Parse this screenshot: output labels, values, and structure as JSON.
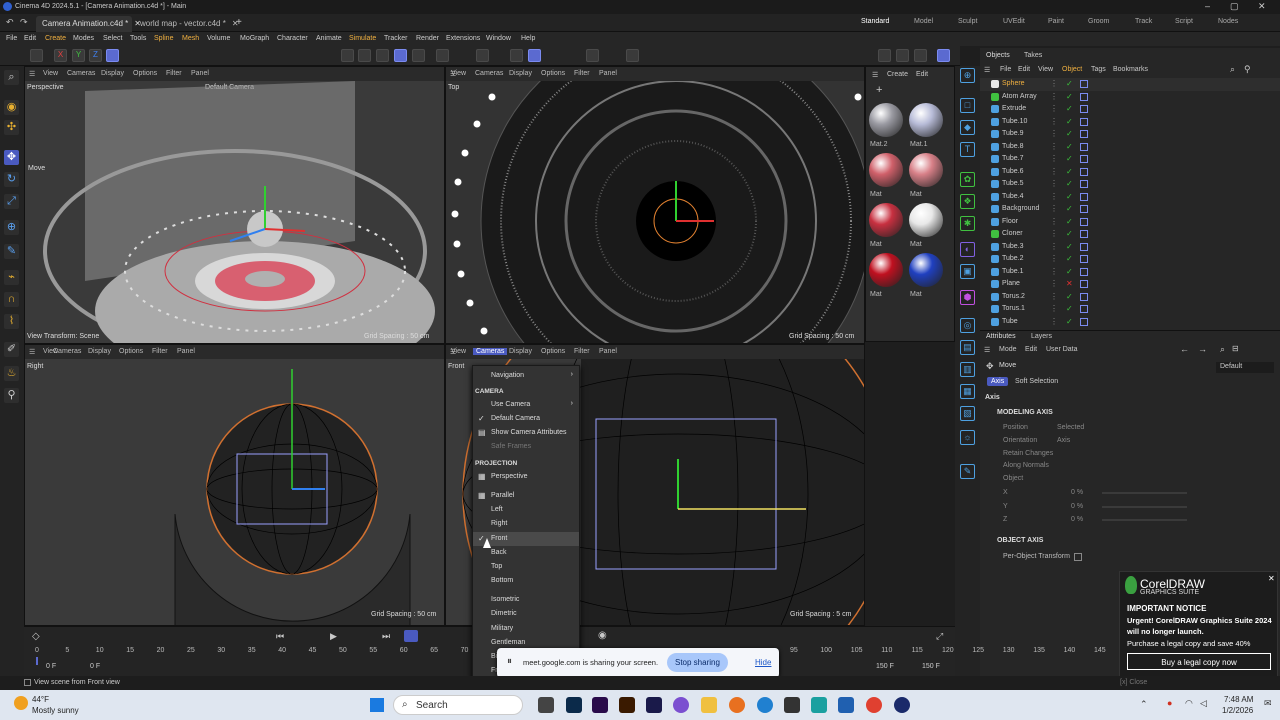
{
  "window": {
    "title": "Cinema 4D 2024.5.1 - [Camera Animation.c4d *] - Main"
  },
  "tabs": [
    {
      "label": "Camera Animation.c4d *",
      "active": true
    },
    {
      "label": "world map - vector.c4d *",
      "active": false
    }
  ],
  "layouts": [
    "Standard",
    "Model",
    "Sculpt",
    "UVEdit",
    "Paint",
    "Groom",
    "Track",
    "Script",
    "Nodes"
  ],
  "menu": [
    "File",
    "Edit",
    "Create",
    "Modes",
    "Select",
    "Tools",
    "Spline",
    "Mesh",
    "Volume",
    "MoGraph",
    "Character",
    "Animate",
    "Simulate",
    "Tracker",
    "Render",
    "Extensions",
    "Window",
    "Help"
  ],
  "viewport_menu": [
    "View",
    "Cameras",
    "Display",
    "Options",
    "Filter",
    "Panel"
  ],
  "viewports": {
    "perspective": {
      "label": "Perspective",
      "camera": "Default Camera",
      "tool": "Move",
      "transform": "View Transform: Scene",
      "grid": "Grid Spacing : 50 cm"
    },
    "top": {
      "label": "Top",
      "grid": "Grid Spacing : 50 cm"
    },
    "right": {
      "label": "Right",
      "grid": "Grid Spacing : 50 cm"
    },
    "front": {
      "label": "Front",
      "grid": "Grid Spacing : 5 cm"
    }
  },
  "materials": {
    "menu": [
      "Create",
      "Edit"
    ],
    "items": [
      {
        "name": "Mat.2",
        "color": "#9a9aa2"
      },
      {
        "name": "Mat.1",
        "color": "#b8bcd8"
      },
      {
        "name": "Mat",
        "color": "#d0606a"
      },
      {
        "name": "Mat",
        "color": "#d88088"
      },
      {
        "name": "Mat",
        "color": "#c83040"
      },
      {
        "name": "Mat",
        "color": "#e8e8e8"
      },
      {
        "name": "Mat",
        "color": "#c01020"
      },
      {
        "name": "Mat",
        "color": "#2040c0"
      }
    ]
  },
  "objects": {
    "tabs": [
      "Objects",
      "Takes"
    ],
    "menu": [
      "File",
      "Edit",
      "View",
      "Object",
      "Tags",
      "Bookmarks"
    ],
    "items": [
      "Sphere",
      "Atom Array",
      "Extrude",
      "Tube.10",
      "Tube.9",
      "Tube.8",
      "Tube.7",
      "Tube.6",
      "Tube.5",
      "Tube.4",
      "Background",
      "Floor",
      "Cloner",
      "Tube.3",
      "Tube.2",
      "Tube.1",
      "Plane",
      "Torus.2",
      "Torus.1",
      "Tube"
    ]
  },
  "attributes": {
    "tabs": [
      "Attributes",
      "Layers"
    ],
    "menu": [
      "Mode",
      "Edit",
      "User Data"
    ],
    "tool": "Move",
    "preset": "Default",
    "subtabs": [
      "Axis",
      "Soft Selection"
    ],
    "section": "Axis",
    "modeling_axis": "MODELING AXIS",
    "fields": [
      {
        "label": "Position",
        "value": "Selected"
      },
      {
        "label": "Orientation",
        "value": "Axis"
      },
      {
        "label": "Retain Changes",
        "value": ""
      },
      {
        "label": "Along Normals",
        "value": ""
      },
      {
        "label": "Object",
        "value": ""
      },
      {
        "label": "X",
        "value": "0 %"
      },
      {
        "label": "Y",
        "value": "0 %"
      },
      {
        "label": "Z",
        "value": "0 %"
      }
    ],
    "object_axis": "OBJECT AXIS",
    "per_object": "Per-Object Transform"
  },
  "context_menu": {
    "navigation": "Navigation",
    "camera_head": "CAMERA",
    "camera_items": [
      "Use Camera",
      "Default Camera",
      "Show Camera Attributes",
      "Safe Frames"
    ],
    "projection_head": "PROJECTION",
    "projection_items": [
      "Perspective",
      "Parallel",
      "Left",
      "Right",
      "Front",
      "Back",
      "Top",
      "Bottom",
      "Isometric",
      "Dimetric",
      "Military",
      "Gentleman",
      "Bird",
      "Frog"
    ],
    "selected": "Front"
  },
  "timeline": {
    "ticks": [
      "0",
      "5",
      "10",
      "15",
      "20",
      "25",
      "30",
      "35",
      "40",
      "45",
      "50",
      "55",
      "60",
      "65",
      "70",
      "95",
      "100",
      "105",
      "110",
      "115",
      "120",
      "125",
      "130",
      "135",
      "140",
      "145",
      "150"
    ],
    "start": "0 F",
    "current": "0 F",
    "end1": "150 F",
    "end2": "150 F"
  },
  "share": {
    "text": "meet.google.com is sharing your screen.",
    "stop": "Stop sharing",
    "hide": "Hide"
  },
  "corel": {
    "brand": "CorelDRAW",
    "sub": "GRAPHICS SUITE",
    "title": "IMPORTANT NOTICE",
    "body": "Urgent! CorelDRAW Graphics Suite 2024 will no longer launch.",
    "offer": "Purchase a legal copy and save 40%",
    "button": "Buy a legal copy now"
  },
  "status": {
    "text": "View scene from Front view",
    "close": "[x] Close"
  },
  "taskbar": {
    "temp": "44°F",
    "weather": "Mostly sunny",
    "search": "Search",
    "time": "7:48 AM",
    "date": "1/2/2026"
  },
  "colors": {
    "accent": "#5b6ad0",
    "selected": "#f0b040",
    "check": "#3ac03a"
  }
}
